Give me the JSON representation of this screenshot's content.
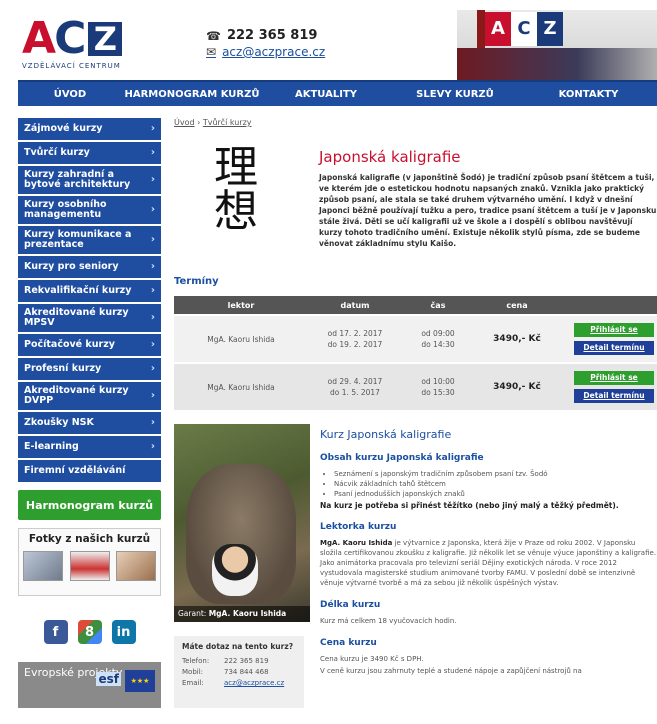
{
  "header": {
    "logo_text": "ACZ",
    "logo_subtitle": "VZDĚLÁVACÍ CENTRUM",
    "phone": "222 365 819",
    "email": "acz@aczprace.cz",
    "banner_letters": [
      "A",
      "C",
      "Z"
    ]
  },
  "nav": {
    "items": [
      "ÚVOD",
      "HARMONOGRAM KURZŮ",
      "AKTUALITY",
      "SLEVY KURZŮ",
      "KONTAKTY"
    ]
  },
  "sidebar": {
    "items": [
      {
        "label": "Zájmové kurzy"
      },
      {
        "label": "Tvůrčí kurzy"
      },
      {
        "label": "Kurzy zahradní a bytové architektury"
      },
      {
        "label": "Kurzy osobního managementu"
      },
      {
        "label": "Kurzy komunikace a prezentace"
      },
      {
        "label": "Kurzy pro seniory"
      },
      {
        "label": "Rekvalifikační kurzy"
      },
      {
        "label": "Akreditované kurzy MPSV"
      },
      {
        "label": "Počítačové kurzy"
      },
      {
        "label": "Profesní kurzy"
      },
      {
        "label": "Akreditované kurzy DVPP"
      },
      {
        "label": "Zkoušky NSK"
      },
      {
        "label": "E-learning"
      },
      {
        "label": "Firemní vzdělávání"
      }
    ],
    "harmonogram_button": "Harmonogram kurzů",
    "photos_title": "Fotky z našich kurzů",
    "eu_text": "Evropské projekty",
    "esf_text": "esf"
  },
  "breadcrumb": {
    "home": "Úvod",
    "separator": "›",
    "current": "Tvůrčí kurzy"
  },
  "intro": {
    "kanji": "理\n想",
    "title": "Japonská kaligrafie",
    "body": "Japonská kaligrafie (v japonštině Šodó) je tradiční způsob psaní štětcem a tuši, ve kterém jde o estetickou hodnotu napsaných znaků. Vznikla jako praktický způsob psaní, ale stala se také druhem výtvarného umění. I když v dnešní Japonci běžně používají tužku a pero, tradice psaní štětcem a tuší je v Japonsku stále živá. Děti se učí kaligrafii už ve škole a i dospělí s oblibou navštěvují kurzy tohoto tradičního umění. Existuje několik stylů písma, zde se budeme věnovat základnímu stylu Kaišo."
  },
  "terminy": {
    "title": "Termíny",
    "headers": [
      "lektor",
      "datum",
      "čas",
      "cena"
    ],
    "rows": [
      {
        "lektor": "MgA. Kaoru Ishida",
        "datum_od": "od 17. 2. 2017",
        "datum_do": "do 19. 2. 2017",
        "cas_od": "od 09:00",
        "cas_do": "do 14:30",
        "cena": "3490,- Kč",
        "signup": "Přihlásit se",
        "detail": "Detail termínu"
      },
      {
        "lektor": "MgA. Kaoru Ishida",
        "datum_od": "od 29. 4. 2017",
        "datum_do": "do 1. 5. 2017",
        "cas_od": "od 10:00",
        "cas_do": "do 15:30",
        "cena": "3490,- Kč",
        "signup": "Přihlásit se",
        "detail": "Detail termínu"
      }
    ]
  },
  "photo": {
    "caption_prefix": "Garant:",
    "caption_name": "MgA. Kaoru Ishida"
  },
  "course": {
    "title": "Kurz Japonská kaligrafie",
    "contents_title": "Obsah kurzu Japonská kaligrafie",
    "contents": [
      "Seznámení s japonským tradičním způsobem psaní tzv. Šodó",
      "Nácvik základních tahů štětcem",
      "Psaní jednodušších japonských znaků"
    ],
    "note": "Na kurz je potřeba si přinést těžítko (nebo jiný malý a těžký předmět).",
    "lector_title": "Lektorka kurzu",
    "lector_name": "MgA. Kaoru Ishida",
    "lector_text": " je výtvarnice z Japonska, která žije v Praze od roku 2002. V Japonsku složila certifikovanou zkoušku z kaligrafie. Již několik let se věnuje výuce japonštiny a kaligrafie. Jako animátorka pracovala pro televizní seriál Dějiny exotických národa. V roce 2012 vystudovala magisterské studium animované tvorby FAMU. V poslední době se intenzivně věnuje výtvarné tvorbě a má za sebou již několik úspěšných výstav.",
    "length_title": "Délka kurzu",
    "length_text": "Kurz má celkem 18 vyučovacích hodin.",
    "price_title": "Cena kurzu",
    "price_text": "Cena kurzu je 3490 Kč s DPH.",
    "price_note": "V ceně kurzu jsou zahrnuty teplé a studené nápoje a zapůjčení nástrojů na"
  },
  "contactbox": {
    "question": "Máte dotaz na tento kurz?",
    "phone_label": "Telefon:",
    "phone": "222 365 819",
    "mobile_label": "Mobil:",
    "mobile": "734 844 468",
    "email_label": "Email:",
    "email": "acz@aczprace.cz"
  },
  "social": [
    "facebook",
    "google-plus",
    "linkedin"
  ],
  "colors": {
    "brand_blue": "#1f4ea1",
    "brand_red": "#c8102e",
    "green": "#2e9e2e"
  }
}
